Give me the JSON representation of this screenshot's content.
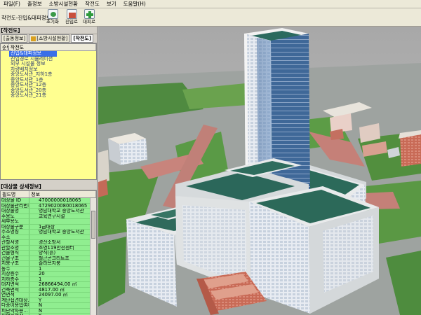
{
  "menu": [
    "파일(F)",
    "출정보",
    "소방시설현황",
    "작전도",
    "보기",
    "도움말(H)"
  ],
  "toolbar": {
    "label": "작전도-진입&대피정보:",
    "buttons": [
      {
        "label": "초기화",
        "icon": "reset-icon"
      },
      {
        "label": "진입로",
        "icon": "entry-route-icon"
      },
      {
        "label": "대피로",
        "icon": "evacuation-route-icon"
      }
    ]
  },
  "left_panel": {
    "title": "[작전도]",
    "tabs": [
      {
        "label": "[출동정보]",
        "active": false
      },
      {
        "label": "[소방시설현황]",
        "active": false
      },
      {
        "label": "[작전도]",
        "active": true
      }
    ],
    "tree_headers": [
      "순번",
      "작전도"
    ],
    "tree_items": [
      {
        "label": "진입&대피정보",
        "selected": true
      },
      {
        "label": "진입경로 시뮬레이션",
        "selected": false
      },
      {
        "label": "외부 시설물 정보",
        "selected": false
      },
      {
        "label": "차량배치정보",
        "selected": false
      },
      {
        "label": "중앙도서관_지하1층",
        "selected": false
      },
      {
        "label": "중앙도서관_1층",
        "selected": false
      },
      {
        "label": "중앙도서관_12층",
        "selected": false
      },
      {
        "label": "중앙도서관_20층",
        "selected": false
      },
      {
        "label": "중앙도서관_21층",
        "selected": false
      }
    ],
    "detail_title": "[대상물 상세정보]",
    "detail_headers": [
      "필드명",
      "정보"
    ],
    "detail_rows": [
      {
        "key": "대상물 ID",
        "value": "47000000018065"
      },
      {
        "key": "대상물관리번호",
        "value": "4729020080018065"
      },
      {
        "key": "대상물명",
        "value": "영남대학교 중앙도서관"
      },
      {
        "key": "주용도",
        "value": "교육연구시설"
      },
      {
        "key": "세부용도",
        "value": ""
      },
      {
        "key": "대상물구분",
        "value": "1급대상"
      },
      {
        "key": "주소명칭",
        "value": "영남대학교 중앙도서관"
      },
      {
        "key": "주소",
        "value": ""
      },
      {
        "key": "관할서명",
        "value": "경산소방서"
      },
      {
        "key": "관할소명",
        "value": "조영119안전센터"
      },
      {
        "key": "건물형식",
        "value": "양식(흙)"
      },
      {
        "key": "건물구조",
        "value": "철근콘크리트조"
      },
      {
        "key": "지붕구조",
        "value": "슬라브지붕"
      },
      {
        "key": "동수",
        "value": "1"
      },
      {
        "key": "지상층수",
        "value": "20"
      },
      {
        "key": "지하층수",
        "value": "1"
      },
      {
        "key": "대지면적",
        "value": "26866494.00 ㎡"
      },
      {
        "key": "건축면적",
        "value": "4817.00 ㎡"
      },
      {
        "key": "연면적",
        "value": "24097.00 ㎡"
      },
      {
        "key": "계단접견대상...",
        "value": "Y"
      },
      {
        "key": "다중이용업여부",
        "value": "N"
      },
      {
        "key": "피난약자용...",
        "value": "N"
      },
      {
        "key": "위험물저장...",
        "value": "Y"
      }
    ]
  }
}
